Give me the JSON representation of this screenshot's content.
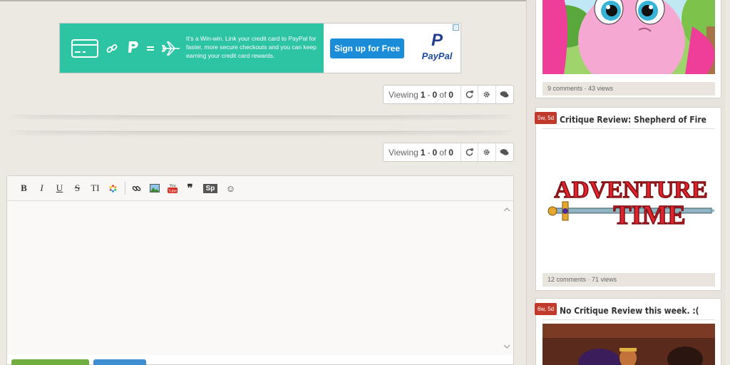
{
  "ad": {
    "text": "It's a Win-win. Link your credit card to PayPal for faster, more secure checkouts and you can keep earning your credit card rewards.",
    "signup_label": "Sign up for Free",
    "paypal_word": "PayPal",
    "paypal_logo": "P",
    "adchoice": "▷",
    "colors": {
      "left_bg": "#2dc4a4",
      "signup_bg": "#1a8cd8"
    }
  },
  "pagers": [
    {
      "prefix": "Viewing",
      "from": "1",
      "sep": "-",
      "to": "0",
      "of_label": "of",
      "total": "0"
    },
    {
      "prefix": "Viewing",
      "from": "1",
      "sep": "-",
      "to": "0",
      "of_label": "of",
      "total": "0"
    }
  ],
  "pager_icons": {
    "refresh": "refresh-icon",
    "settings": "gear-icon",
    "comments": "comments-icon"
  },
  "editor": {
    "toolbar": {
      "bold": "B",
      "italic": "I",
      "underline": "U",
      "strike": "S",
      "size": "TI",
      "sp": "Sp",
      "emoji": "☺",
      "quote": "❞",
      "youtube_top": "You",
      "youtube_bottom": "Tube"
    }
  },
  "sidebar": {
    "cards": [
      {
        "stats": "9 comments · 43 views"
      },
      {
        "tag": "5w, 5d",
        "title": "Critique Review: Shepherd of Fire",
        "image_title_line1": "ADVENTURE",
        "image_title_line2": "TIME",
        "stats": "12 comments · 71 views"
      },
      {
        "tag": "6w, 5d",
        "title": "No Critique Review this week. :("
      }
    ]
  }
}
